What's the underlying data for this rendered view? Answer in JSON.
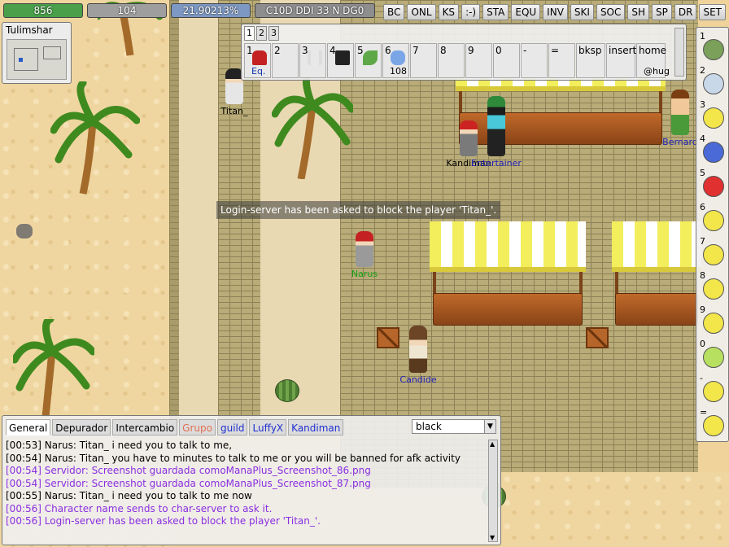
{
  "hud": {
    "hp": "856",
    "mp": "104",
    "xp": "21.90213%",
    "money": "C10D DDI 33 N DG0",
    "hp_color": "#4aa04a",
    "mp_color": "#9e9e9e",
    "xp_color": "#7d98c2"
  },
  "window_tabs": [
    "BC",
    "ONL",
    "KS",
    ":-)",
    "STA",
    "EQU",
    "INV",
    "SKI",
    "SOC",
    "SH",
    "SP",
    "DR",
    "SET"
  ],
  "minimap": {
    "title": "Tulimshar"
  },
  "shortcuts": {
    "tabs": [
      "1",
      "2",
      "3"
    ],
    "slots": [
      {
        "key": "1",
        "label": "Eq.",
        "icon": "gm-cap-icon"
      },
      {
        "key": "2",
        "label": "",
        "icon": ""
      },
      {
        "key": "3",
        "label": "",
        "icon": "bunny-ears-icon"
      },
      {
        "key": "4",
        "label": "",
        "icon": "top-hat-icon"
      },
      {
        "key": "5",
        "label": "",
        "icon": "herb-icon"
      },
      {
        "key": "6",
        "label": "108",
        "icon": "potion-icon"
      },
      {
        "key": "7",
        "label": "",
        "icon": ""
      },
      {
        "key": "8",
        "label": "",
        "icon": ""
      },
      {
        "key": "9",
        "label": "",
        "icon": ""
      },
      {
        "key": "0",
        "label": "",
        "icon": ""
      },
      {
        "key": "-",
        "label": "",
        "icon": ""
      },
      {
        "key": "=",
        "label": "",
        "icon": ""
      },
      {
        "key": "bksp",
        "label": "",
        "icon": ""
      },
      {
        "key": "insert",
        "label": "",
        "icon": ""
      },
      {
        "key": "home",
        "label": "@hug",
        "icon": ""
      }
    ]
  },
  "emotes": [
    "1",
    "2",
    "3",
    "4",
    "5",
    "6",
    "7",
    "8",
    "9",
    "0",
    "-",
    "="
  ],
  "world": {
    "notice": "Login-server has been asked to block the player 'Titan_'.",
    "npcs": {
      "titan": "Titan_",
      "kandiman": "Kandiman",
      "entertainer": "Entertainer",
      "bernard": "Bernard",
      "narus": "Narus",
      "candide": "Candide"
    },
    "gm_badge": "GM"
  },
  "chat": {
    "tabs": [
      "General",
      "Depurador",
      "Intercambio",
      "Grupo",
      "guild",
      "LuffyX",
      "Kandiman"
    ],
    "color_select": "black",
    "lines": [
      {
        "text": "[00:53] Narus: Titan_ i need you to talk to me,",
        "kind": "normal"
      },
      {
        "text": "[00:54] Narus: Titan_ you have to minutes to talk to me or you will be banned for afk activity",
        "kind": "normal"
      },
      {
        "text": "[00:54] Servidor: Screenshot guardada comoManaPlus_Screenshot_86.png",
        "kind": "system"
      },
      {
        "text": "[00:54] Servidor: Screenshot guardada comoManaPlus_Screenshot_87.png",
        "kind": "system"
      },
      {
        "text": "[00:55] Narus: Titan_ i need you to talk to me now",
        "kind": "normal"
      },
      {
        "text": "[00:56] Character name sends to char-server to ask it.",
        "kind": "system"
      },
      {
        "text": "[00:56] Login-server has been asked to block the player 'Titan_'.",
        "kind": "system"
      }
    ]
  }
}
